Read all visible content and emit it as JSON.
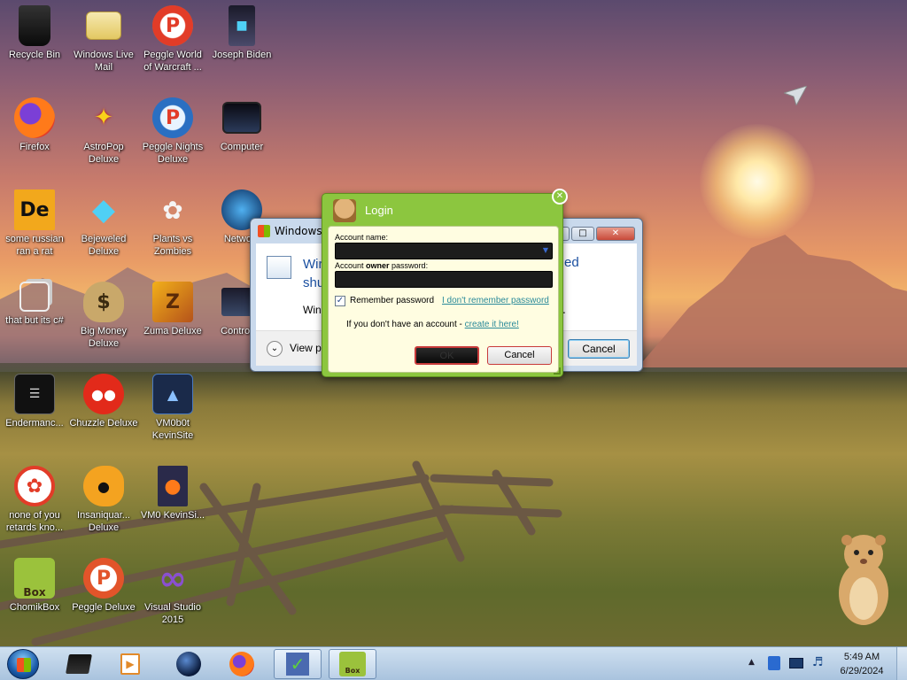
{
  "desktop_icons": [
    {
      "label": "Recycle Bin",
      "icon": "recycle-bin-icon"
    },
    {
      "label": "Windows Live Mail",
      "icon": "mail-icon"
    },
    {
      "label": "Peggle World of Warcraft ...",
      "icon": "peggle-icon"
    },
    {
      "label": "Joseph Biden",
      "icon": "computer-tower-icon"
    },
    {
      "label": "Firefox",
      "icon": "firefox-icon"
    },
    {
      "label": "AstroPop Deluxe",
      "icon": "astropop-icon"
    },
    {
      "label": "Peggle Nights Deluxe",
      "icon": "peggle-icon"
    },
    {
      "label": "Computer",
      "icon": "monitor-icon"
    },
    {
      "label": "some russian ran a rat",
      "icon": "de-icon"
    },
    {
      "label": "Bejeweled Deluxe",
      "icon": "gem-icon"
    },
    {
      "label": "Plants vs Zombies",
      "icon": "plants-icon"
    },
    {
      "label": "Netwo...",
      "icon": "network-icon"
    },
    {
      "label": "that but its c#",
      "icon": "windows-stack-icon"
    },
    {
      "label": "Big Money Deluxe",
      "icon": "money-bag-icon"
    },
    {
      "label": "Zuma Deluxe",
      "icon": "zuma-icon"
    },
    {
      "label": "Control ...",
      "icon": "control-panel-icon"
    },
    {
      "label": "Endermanc...",
      "icon": "terminal-icon"
    },
    {
      "label": "Chuzzle Deluxe",
      "icon": "chuzzle-icon"
    },
    {
      "label": "VM0b0t KevinSite",
      "icon": "vm-icon"
    },
    {
      "label": "none of you retards kno...",
      "icon": "dragon-icon"
    },
    {
      "label": "Insaniquar... Deluxe",
      "icon": "fish-icon"
    },
    {
      "label": "VM0 KevinSi...",
      "icon": "firefox-doc-icon"
    },
    {
      "label": "ChomikBox",
      "icon": "hamster-box-icon"
    },
    {
      "label": "Peggle Deluxe",
      "icon": "peggle-icon"
    },
    {
      "label": "Visual Studio 2015",
      "icon": "visual-studio-icon"
    }
  ],
  "back_window": {
    "title": "Windows",
    "heading_line1": "Wir",
    "heading_tail1": "ed",
    "heading_line2": "shu",
    "body_text": "Win",
    "body_tail": ".",
    "details_label": "View p",
    "cancel_label": "Cancel"
  },
  "login": {
    "title": "Login",
    "account_name_label": "Account name:",
    "owner_prefix": "Account ",
    "owner_bold": "owner",
    "owner_suffix": " password:",
    "remember_label": "Remember password",
    "forgot_link": "I don't remember password",
    "signup_text": "If you don't have an account - ",
    "signup_link": "create it here!",
    "ok_label": "OK",
    "cancel_label": "Cancel"
  },
  "taskbar": {
    "time": "5:49 AM",
    "date": "6/29/2024"
  },
  "colors": {
    "login_green": "#8cc63f",
    "login_panel": "#fffde1",
    "link": "#2a8a9a"
  }
}
